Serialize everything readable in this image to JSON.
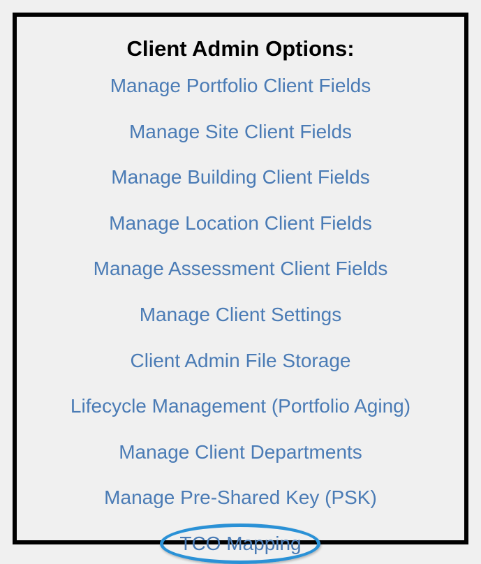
{
  "heading": "Client Admin Options:",
  "options": [
    {
      "label": "Manage Portfolio Client Fields",
      "highlighted": false
    },
    {
      "label": "Manage Site Client Fields",
      "highlighted": false
    },
    {
      "label": "Manage Building Client Fields",
      "highlighted": false
    },
    {
      "label": "Manage Location Client Fields",
      "highlighted": false
    },
    {
      "label": "Manage Assessment Client Fields",
      "highlighted": false
    },
    {
      "label": "Manage Client Settings",
      "highlighted": false
    },
    {
      "label": "Client Admin File Storage",
      "highlighted": false
    },
    {
      "label": "Lifecycle Management (Portfolio Aging)",
      "highlighted": false
    },
    {
      "label": "Manage Client Departments",
      "highlighted": false
    },
    {
      "label": "Manage Pre-Shared Key (PSK)",
      "highlighted": false
    },
    {
      "label": "TCO Mapping",
      "highlighted": true
    }
  ]
}
